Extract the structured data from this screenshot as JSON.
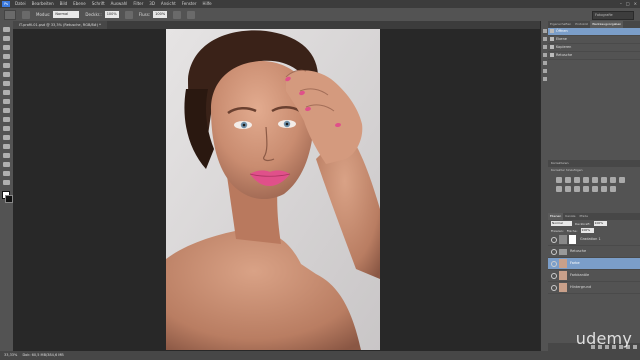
{
  "menubar": {
    "logo": "Ps",
    "items": [
      "Datei",
      "Bearbeiten",
      "Bild",
      "Ebene",
      "Schrift",
      "Auswahl",
      "Filter",
      "3D",
      "Ansicht",
      "Fenster",
      "Hilfe"
    ],
    "controls": [
      "–",
      "□",
      "×"
    ]
  },
  "options": {
    "mode_label": "Modus:",
    "mode_value": "Normal",
    "opacity_label": "Deckkr.:",
    "opacity_value": "100%",
    "flow_label": "Fluss:",
    "flow_value": "100%",
    "workspace": "Fotografie"
  },
  "document": {
    "tab_title": "IT-profil-01.psd @ 33,3% (Retusche, RGB/8#) *"
  },
  "status": {
    "zoom": "33,33%",
    "doc_info": "Dok: 60,5 MB/384,6 MB"
  },
  "panels": {
    "top_tabs": [
      "Eigenschaften",
      "Protokoll",
      "Werkzeugvorgaben"
    ],
    "history": [
      {
        "label": "Öffnen",
        "selected": true
      },
      {
        "label": "Ebene",
        "selected": false
      },
      {
        "label": "Kopieren",
        "selected": false
      },
      {
        "label": "Retusche",
        "selected": false
      }
    ],
    "adjust_header": "Korrekturen",
    "adjust_sub": "Korrektur hinzufügen",
    "layer_tabs": [
      "Ebenen",
      "Kanäle",
      "Pfade"
    ],
    "blend_mode": "Normal",
    "opacity_label": "Deckkraft:",
    "opacity_value": "100%",
    "fix_label": "Fixieren:",
    "fill_label": "Fläche:",
    "fill_value": "100%",
    "layers": [
      {
        "name": "Gradation 1",
        "selected": false,
        "mask": true,
        "group": false
      },
      {
        "name": "Retusche",
        "selected": false,
        "mask": false,
        "group": true
      },
      {
        "name": "Farbe",
        "selected": true,
        "mask": false,
        "group": false
      },
      {
        "name": "Farbkanäle",
        "selected": false,
        "mask": false,
        "group": false
      },
      {
        "name": "Hintergrund",
        "selected": false,
        "mask": false,
        "group": false
      }
    ]
  },
  "watermark": "udemy",
  "colors": {
    "accent": "#7b9ec9",
    "app_dark": "#282828",
    "panel": "#535353",
    "lips": "#e0508a"
  }
}
